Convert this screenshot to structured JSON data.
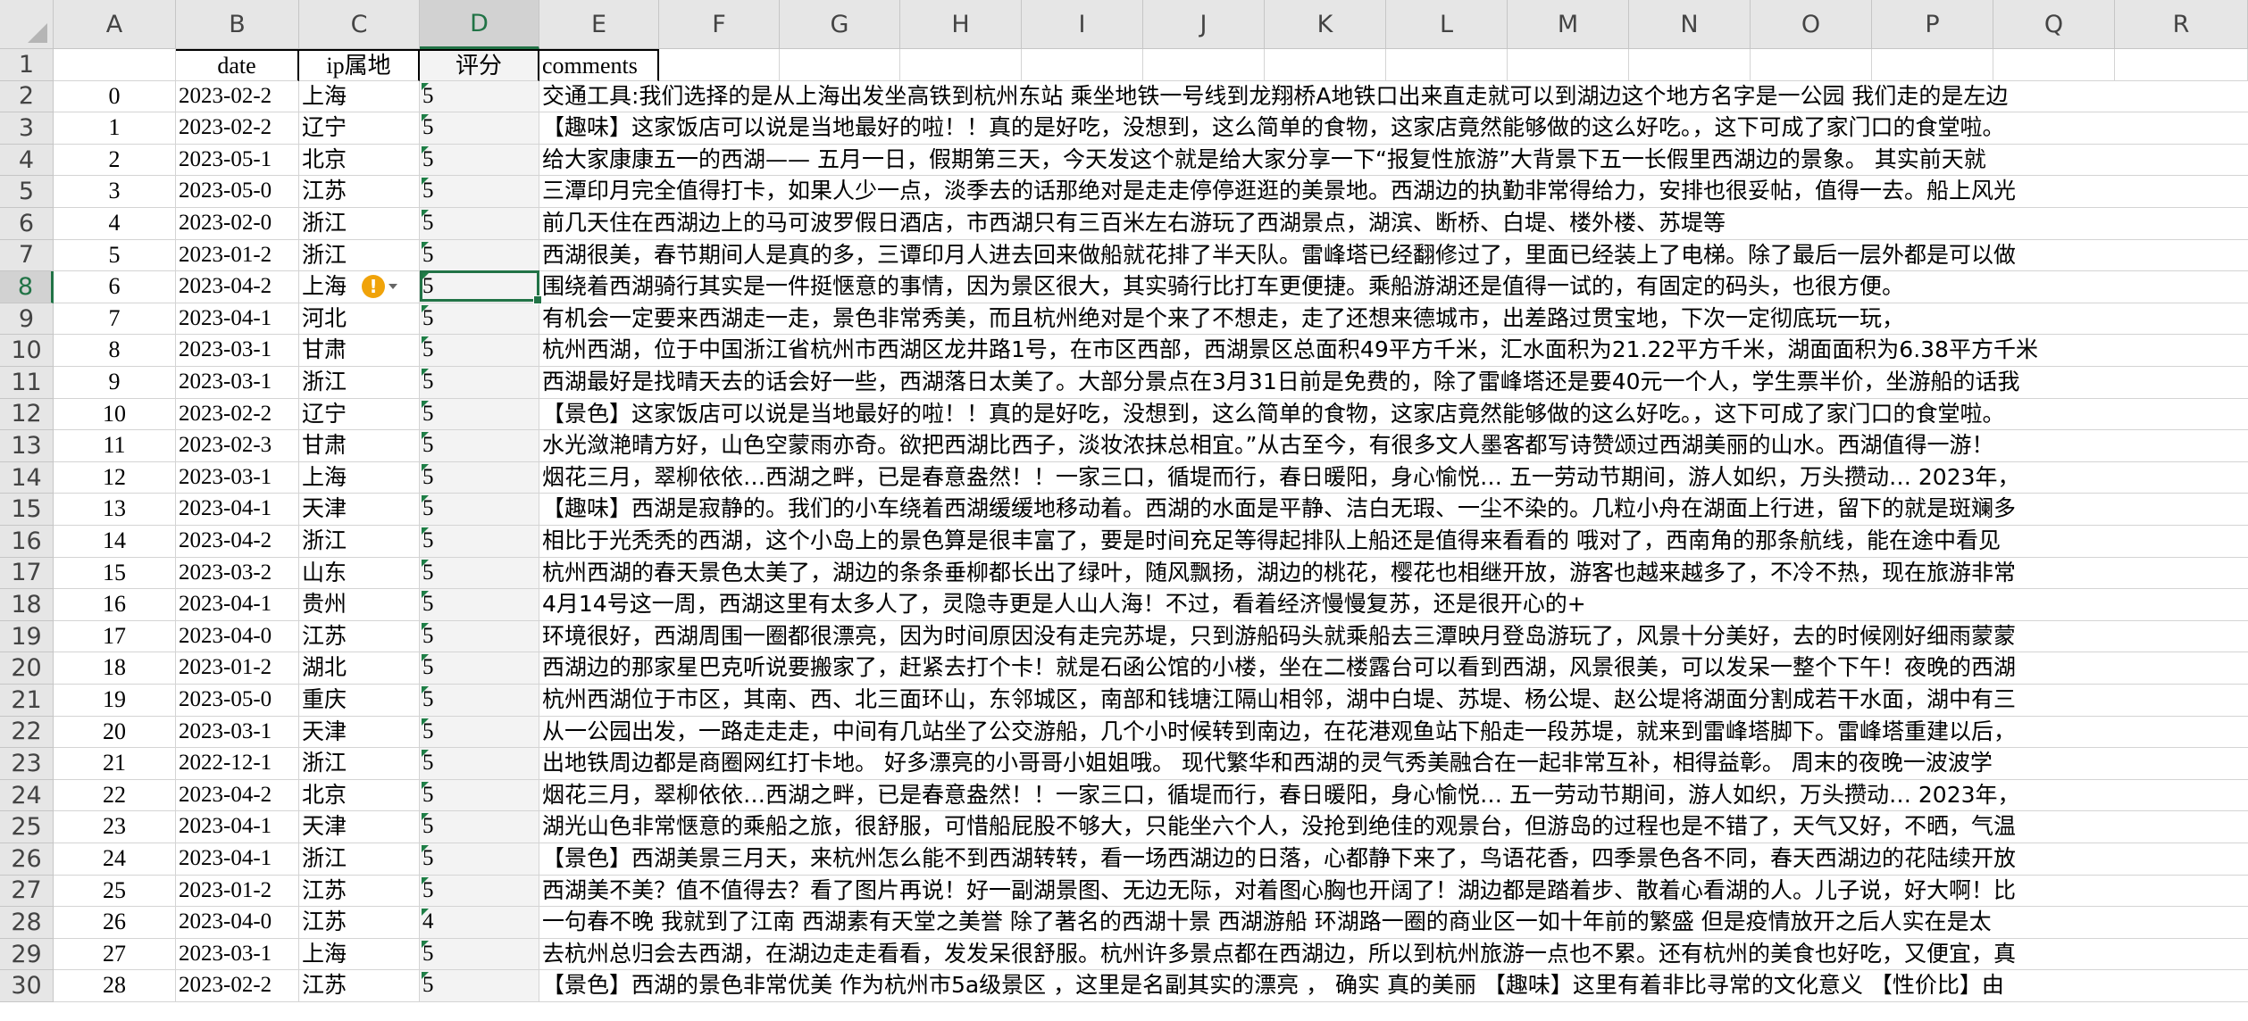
{
  "columns": [
    "A",
    "B",
    "C",
    "D",
    "E",
    "F",
    "G",
    "H",
    "I",
    "J",
    "K",
    "L",
    "M",
    "N",
    "O",
    "P",
    "Q",
    "R"
  ],
  "selected_column": "D",
  "selected_row": "8",
  "headers": {
    "a": "",
    "b": "date",
    "c": "ip属地",
    "d": "评分",
    "e": "comments"
  },
  "warning_icon": "warning-icon",
  "rows": [
    {
      "num": "2",
      "idx": "0",
      "date": "2023-02-2",
      "ip": "上海",
      "score": "5",
      "comment": "交通工具:我们选择的是从上海出发坐高铁到杭州东站 乘坐地铁一号线到龙翔桥A地铁口出来直走就可以到湖边这个地方名字是一公园 我们走的是左边"
    },
    {
      "num": "3",
      "idx": "1",
      "date": "2023-02-2",
      "ip": "辽宁",
      "score": "5",
      "comment": "【趣味】这家饭店可以说是当地最好的啦！！真的是好吃，没想到，这么简单的食物，这家店竟然能够做的这么好吃。，这下可成了家门口的食堂啦。"
    },
    {
      "num": "4",
      "idx": "2",
      "date": "2023-05-1",
      "ip": "北京",
      "score": "5",
      "comment": "给大家康康五一的西湖—— 五月一日，假期第三天，今天发这个就是给大家分享一下“报复性旅游”大背景下五一长假里西湖边的景象。 其实前天就"
    },
    {
      "num": "5",
      "idx": "3",
      "date": "2023-05-0",
      "ip": "江苏",
      "score": "5",
      "comment": "三潭印月完全值得打卡，如果人少一点，淡季去的话那绝对是走走停停逛逛的美景地。西湖边的执勤非常得给力，安排也很妥帖，值得一去。船上风光"
    },
    {
      "num": "6",
      "idx": "4",
      "date": "2023-02-0",
      "ip": "浙江",
      "score": "5",
      "comment": "前几天住在西湖边上的马可波罗假日酒店，市西湖只有三百米左右游玩了西湖景点，湖滨、断桥、白堤、楼外楼、苏堤等"
    },
    {
      "num": "7",
      "idx": "5",
      "date": "2023-01-2",
      "ip": "浙江",
      "score": "5",
      "comment": "西湖很美，春节期间人是真的多，三谭印月人进去回来做船就花排了半天队。雷峰塔已经翻修过了，里面已经装上了电梯。除了最后一层外都是可以做"
    },
    {
      "num": "8",
      "idx": "6",
      "date": "2023-04-2",
      "ip": "上海",
      "score": "5",
      "comment": "围绕着西湖骑行其实是一件挺惬意的事情，因为景区很大，其实骑行比打车更便捷。乘船游湖还是值得一试的，有固定的码头，也很方便。"
    },
    {
      "num": "9",
      "idx": "7",
      "date": "2023-04-1",
      "ip": "河北",
      "score": "5",
      "comment": "有机会一定要来西湖走一走，景色非常秀美，而且杭州绝对是个来了不想走，走了还想来德城市，出差路过贯宝地，下次一定彻底玩一玩，"
    },
    {
      "num": "10",
      "idx": "8",
      "date": "2023-03-1",
      "ip": "甘肃",
      "score": "5",
      "comment": "杭州西湖，位于中国浙江省杭州市西湖区龙井路1号，在市区西部，西湖景区总面积49平方千米，汇水面积为21.22平方千米，湖面面积为6.38平方千米"
    },
    {
      "num": "11",
      "idx": "9",
      "date": "2023-03-1",
      "ip": "浙江",
      "score": "5",
      "comment": "西湖最好是找晴天去的话会好一些，西湖落日太美了。大部分景点在3月31日前是免费的，除了雷峰塔还是要40元一个人，学生票半价，坐游船的话我"
    },
    {
      "num": "12",
      "idx": "10",
      "date": "2023-02-2",
      "ip": "辽宁",
      "score": "5",
      "comment": "【景色】这家饭店可以说是当地最好的啦！！真的是好吃，没想到，这么简单的食物，这家店竟然能够做的这么好吃。，这下可成了家门口的食堂啦。"
    },
    {
      "num": "13",
      "idx": "11",
      "date": "2023-02-3",
      "ip": "甘肃",
      "score": "5",
      "comment": "水光潋滟晴方好，山色空蒙雨亦奇。欲把西湖比西子，淡妆浓抹总相宜。”从古至今，有很多文人墨客都写诗赞颂过西湖美丽的山水。西湖值得一游！"
    },
    {
      "num": "14",
      "idx": "12",
      "date": "2023-03-1",
      "ip": "上海",
      "score": "5",
      "comment": "烟花三月，翠柳依依…西湖之畔，已是春意盎然！！一家三口，循堤而行，春日暖阳，身心愉悦… 五一劳动节期间，游人如织，万头攒动… 2023年，"
    },
    {
      "num": "15",
      "idx": "13",
      "date": "2023-04-1",
      "ip": "天津",
      "score": "5",
      "comment": "【趣味】西湖是寂静的。我们的小车绕着西湖缓缓地移动着。西湖的水面是平静、洁白无瑕、一尘不染的。几粒小舟在湖面上行进，留下的就是斑斓多"
    },
    {
      "num": "16",
      "idx": "14",
      "date": "2023-04-2",
      "ip": "浙江",
      "score": "5",
      "comment": "相比于光秃秃的西湖，这个小岛上的景色算是很丰富了，要是时间充足等得起排队上船还是值得来看看的 哦对了，西南角的那条航线，能在途中看见"
    },
    {
      "num": "17",
      "idx": "15",
      "date": "2023-03-2",
      "ip": "山东",
      "score": "5",
      "comment": "杭州西湖的春天景色太美了，湖边的条条垂柳都长出了绿叶，随风飘扬，湖边的桃花，樱花也相继开放，游客也越来越多了，不冷不热，现在旅游非常"
    },
    {
      "num": "18",
      "idx": "16",
      "date": "2023-04-1",
      "ip": "贵州",
      "score": "5",
      "comment": "4月14号这一周，西湖这里有太多人了，灵隐寺更是人山人海！不过，看着经济慢慢复苏，还是很开心的+"
    },
    {
      "num": "19",
      "idx": "17",
      "date": "2023-04-0",
      "ip": "江苏",
      "score": "5",
      "comment": "环境很好，西湖周围一圈都很漂亮，因为时间原因没有走完苏堤，只到游船码头就乘船去三潭映月登岛游玩了，风景十分美好，去的时候刚好细雨蒙蒙"
    },
    {
      "num": "20",
      "idx": "18",
      "date": "2023-01-2",
      "ip": "湖北",
      "score": "5",
      "comment": "西湖边的那家星巴克听说要搬家了，赶紧去打个卡！就是石函公馆的小楼，坐在二楼露台可以看到西湖，风景很美，可以发呆一整个下午！夜晚的西湖"
    },
    {
      "num": "21",
      "idx": "19",
      "date": "2023-05-0",
      "ip": "重庆",
      "score": "5",
      "comment": "杭州西湖位于市区，其南、西、北三面环山，东邻城区，南部和钱塘江隔山相邻，湖中白堤、苏堤、杨公堤、赵公堤将湖面分割成若干水面，湖中有三"
    },
    {
      "num": "22",
      "idx": "20",
      "date": "2023-03-1",
      "ip": "天津",
      "score": "5",
      "comment": "从一公园出发，一路走走走，中间有几站坐了公交游船，几个小时候转到南边，在花港观鱼站下船走一段苏堤，就来到雷峰塔脚下。雷峰塔重建以后，"
    },
    {
      "num": "23",
      "idx": "21",
      "date": "2022-12-1",
      "ip": "浙江",
      "score": "5",
      "comment": "出地铁周边都是商圈网红打卡地。 好多漂亮的小哥哥小姐姐哦。 现代繁华和西湖的灵气秀美融合在一起非常互补，相得益彰。 周末的夜晚一波波学"
    },
    {
      "num": "24",
      "idx": "22",
      "date": "2023-04-2",
      "ip": "北京",
      "score": "5",
      "comment": "烟花三月，翠柳依依…西湖之畔，已是春意盎然！！一家三口，循堤而行，春日暖阳，身心愉悦… 五一劳动节期间，游人如织，万头攒动… 2023年，"
    },
    {
      "num": "25",
      "idx": "23",
      "date": "2023-04-1",
      "ip": "天津",
      "score": "5",
      "comment": "湖光山色非常惬意的乘船之旅，很舒服，可惜船屁股不够大，只能坐六个人，没抢到绝佳的观景台，但游岛的过程也是不错了，天气又好，不晒，气温"
    },
    {
      "num": "26",
      "idx": "24",
      "date": "2023-04-1",
      "ip": "浙江",
      "score": "5",
      "comment": "【景色】西湖美景三月天，来杭州怎么能不到西湖转转，看一场西湖边的日落，心都静下来了，鸟语花香，四季景色各不同，春天西湖边的花陆续开放"
    },
    {
      "num": "27",
      "idx": "25",
      "date": "2023-01-2",
      "ip": "江苏",
      "score": "5",
      "comment": "西湖美不美？值不值得去？看了图片再说！好一副湖景图、无边无际，对着图心胸也开阔了！湖边都是踏着步、散着心看湖的人。儿子说，好大啊！比"
    },
    {
      "num": "28",
      "idx": "26",
      "date": "2023-04-0",
      "ip": "江苏",
      "score": "4",
      "comment": "一句春不晚 我就到了江南 西湖素有天堂之美誉 除了著名的西湖十景 西湖游船 环湖路一圈的商业区一如十年前的繁盛 但是疫情放开之后人实在是太"
    },
    {
      "num": "29",
      "idx": "27",
      "date": "2023-03-1",
      "ip": "上海",
      "score": "5",
      "comment": "去杭州总归会去西湖，在湖边走走看看，发发呆很舒服。杭州许多景点都在西湖边，所以到杭州旅游一点也不累。还有杭州的美食也好吃，又便宜，真"
    },
    {
      "num": "30",
      "idx": "28",
      "date": "2023-02-2",
      "ip": "江苏",
      "score": "5",
      "comment": "【景色】西湖的景色非常优美 作为杭州市5a级景区 ，这里是名副其实的漂亮 ， 确实 真的美丽 【趣味】这里有着非比寻常的文化意义 【性价比】由"
    }
  ]
}
